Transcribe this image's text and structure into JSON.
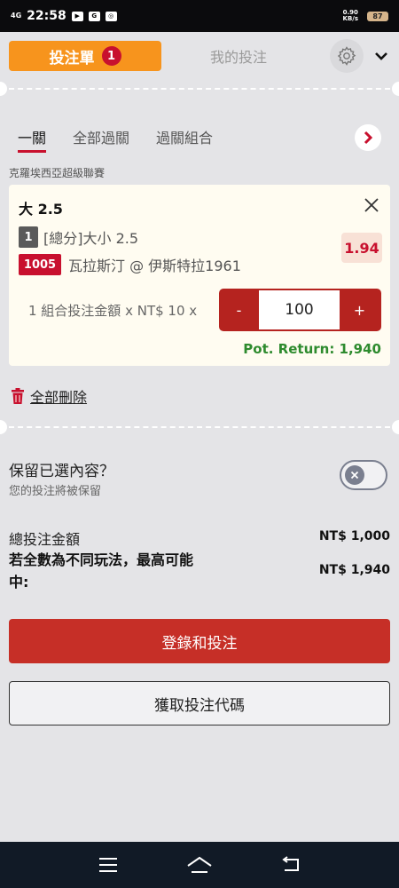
{
  "status_bar": {
    "network": "4G",
    "time": "22:58",
    "speed_value": "0.90",
    "speed_unit": "KB/s",
    "battery": "87"
  },
  "header": {
    "betslip_tab": "投注單",
    "betslip_count": "1",
    "my_bets_tab": "我的投注"
  },
  "subtabs": [
    "一關",
    "全部過關",
    "過關組合"
  ],
  "league": "克羅埃西亞超級聯賽",
  "selection": {
    "title": "大 2.5",
    "index": "1",
    "market": "[總分]大小 2.5",
    "event_code": "1005",
    "match": "瓦拉斯汀 @ 伊斯特拉1961",
    "odds": "1.94",
    "stake_label": "1 組合投注金額 x NT$ 10 x",
    "minus": "-",
    "stake": "100",
    "plus": "+",
    "pot_return": "Pot. Return: 1,940"
  },
  "delete_all": "全部刪除",
  "keep": {
    "title": "保留已選內容？",
    "subtitle": "您的投注將被保留",
    "enabled": false
  },
  "summary": {
    "total_label": "總投注金額",
    "total_value": "NT$ 1,000",
    "maxwin_label": "若全數為不同玩法，最高可能中:",
    "maxwin_value": "NT$ 1,940"
  },
  "buttons": {
    "login_bet": "登錄和投注",
    "get_code": "獲取投注代碼"
  },
  "colors": {
    "accent_orange": "#f7941d",
    "brand_red": "#c8102e",
    "odds_red": "#c8102e",
    "return_green": "#2e8b2e"
  }
}
